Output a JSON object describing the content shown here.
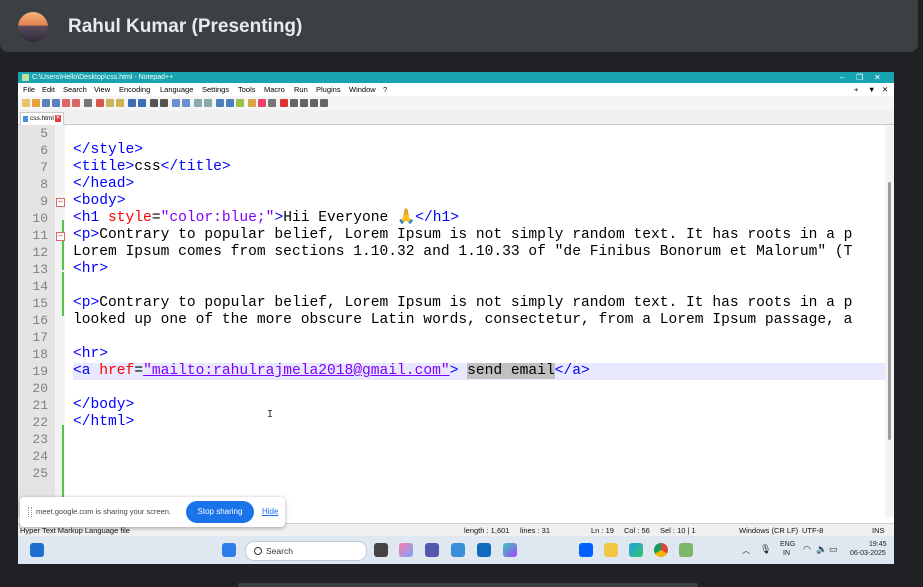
{
  "meet": {
    "presenter": "Rahul Kumar (Presenting)",
    "banner_message": "meet.google.com is sharing your screen.",
    "stop_sharing": "Stop sharing",
    "hide": "Hide"
  },
  "window": {
    "title": "C:\\Users\\Hello\\Desktop\\css.html - Notepad++",
    "controls": [
      "–",
      "❐",
      "✕"
    ],
    "menu": [
      "File",
      "Edit",
      "Search",
      "View",
      "Encoding",
      "Language",
      "Settings",
      "Tools",
      "Macro",
      "Run",
      "Plugins",
      "Window",
      "?"
    ],
    "menu_right": [
      "+",
      "▼",
      "✕"
    ]
  },
  "tab": {
    "label": "css.html",
    "close": "✕"
  },
  "editor": {
    "lines": [
      {
        "n": "5"
      },
      {
        "n": "6"
      },
      {
        "n": "7"
      },
      {
        "n": "8"
      },
      {
        "n": "9"
      },
      {
        "n": "10"
      },
      {
        "n": "11"
      },
      {
        "n": "12"
      },
      {
        "n": "13"
      },
      {
        "n": "14"
      },
      {
        "n": "15"
      },
      {
        "n": "16"
      },
      {
        "n": "17"
      },
      {
        "n": "18"
      },
      {
        "n": "19"
      },
      {
        "n": "20"
      },
      {
        "n": "21"
      },
      {
        "n": "22"
      },
      {
        "n": "23"
      },
      {
        "n": "24"
      },
      {
        "n": "25"
      }
    ],
    "code": {
      "l6": "</style>",
      "l7_a": "<title>",
      "l7_b": "css",
      "l7_c": "</title>",
      "l8": "</head>",
      "l9": "<body>",
      "l10_a": "<h1 ",
      "l10_b": "style",
      "l10_c": "=",
      "l10_d": "\"color:blue;\"",
      "l10_e": ">",
      "l10_f": "Hii Everyone 🙏",
      "l10_g": "</h1>",
      "l11_a": "<p>",
      "l11_b": "Contrary to popular belief, Lorem Ipsum is not simply random text. It has roots in a p",
      "l12": "Lorem Ipsum comes from sections 1.10.32 and 1.10.33 of \"de Finibus Bonorum et Malorum\" (T",
      "l13": "<hr>",
      "l15_a": "<p>",
      "l15_b": "Contrary to popular belief, Lorem Ipsum is not simply random text. It has roots in a p",
      "l16": "looked up one of the more obscure Latin words, consectetur, from a Lorem Ipsum passage, a",
      "l18": "<hr>",
      "l19_a": "<a ",
      "l19_b": "href",
      "l19_c": "=",
      "l19_d": "\"mailto:rahulrajmela2018@gmail.com\"",
      "l19_e": "> ",
      "l19_f": "send email",
      "l19_g": "</a>",
      "l21": "</body>",
      "l22": "</html>"
    }
  },
  "status": {
    "filetype": "Hyper Text Markup Language file",
    "length": "length : 1,601",
    "lines": "lines : 31",
    "ln": "Ln : 19",
    "col": "Col : 56",
    "sel": "Sel : 10 | 1",
    "eol": "Windows (CR LF)",
    "encoding": "UTF-8",
    "mode": "INS"
  },
  "taskbar": {
    "search_placeholder": "Search",
    "lang_top": "ENG",
    "lang_bottom": "IN",
    "time": "19:45",
    "date": "06-03-2025"
  },
  "colors": {
    "titlebar": "#17a3b0",
    "tag": "#0000ff",
    "attribute": "#ff0000",
    "value": "#8000ff",
    "stop_sharing_button": "#1a73e8"
  }
}
